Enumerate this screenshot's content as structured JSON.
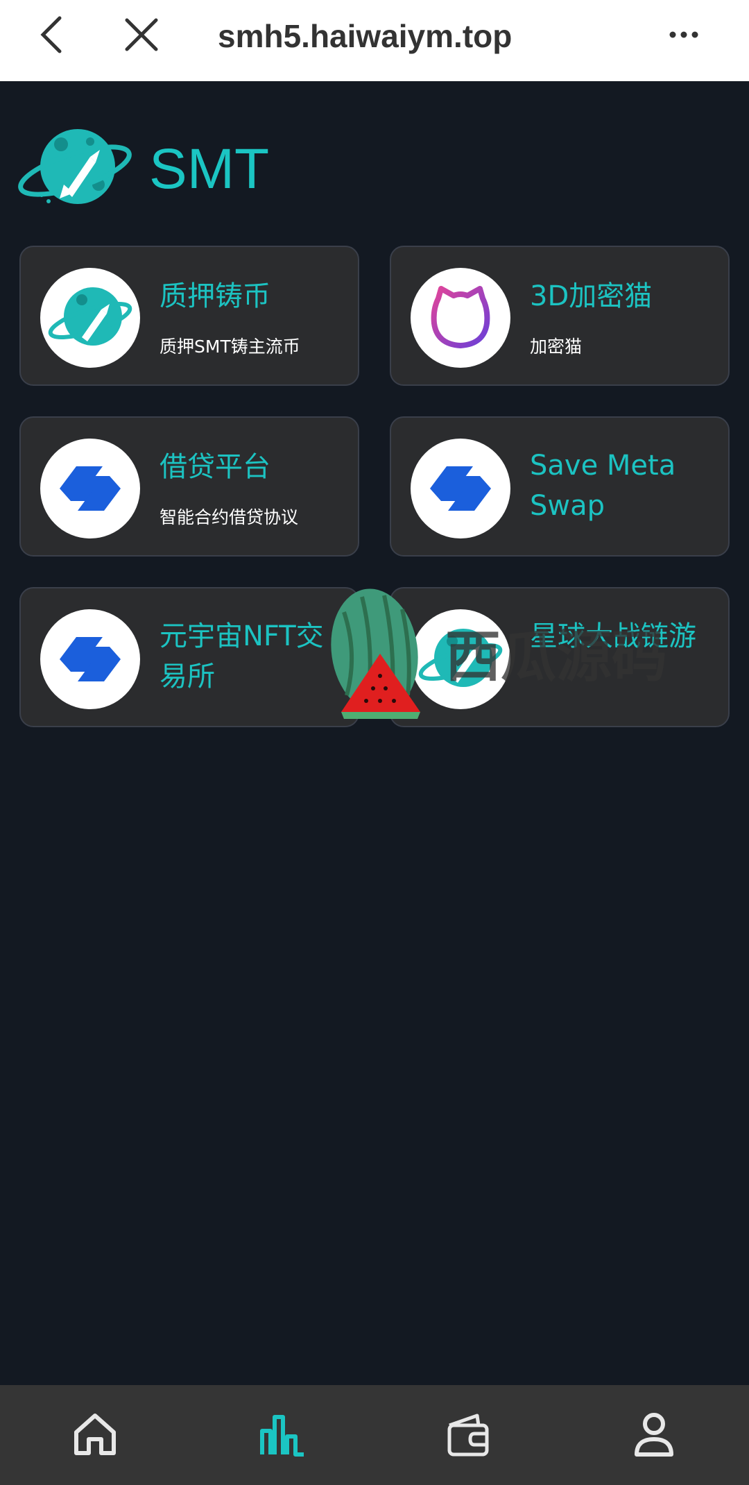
{
  "browser": {
    "url": "smh5.haiwaiym.top",
    "back_icon": "chevron-left-icon",
    "close_icon": "close-icon",
    "more_icon": "more-dots-icon"
  },
  "header": {
    "brand": "SMT",
    "logo_icon": "planet-rocket-logo"
  },
  "cards": [
    {
      "title": "质押铸币",
      "subtitle": "质押SMT铸主流币",
      "icon": "planet-rocket-icon"
    },
    {
      "title": "3D加密猫",
      "subtitle": "加密猫",
      "icon": "cat-icon"
    },
    {
      "title": "借贷平台",
      "subtitle": "智能合约借贷协议",
      "icon": "swap-logo-icon"
    },
    {
      "title": "Save Meta Swap",
      "subtitle": "",
      "icon": "swap-logo-icon"
    },
    {
      "title": "元宇宙NFT交易所",
      "subtitle": "",
      "icon": "swap-logo-icon"
    },
    {
      "title": "星球大战链游",
      "subtitle": "",
      "icon": "planet-rocket-icon"
    }
  ],
  "watermark": {
    "text": "西瓜源码",
    "icon": "watermelon-icon"
  },
  "bottom_nav": [
    {
      "name": "home",
      "icon": "home-icon",
      "active": false
    },
    {
      "name": "market",
      "icon": "chart-bars-icon",
      "active": true
    },
    {
      "name": "wallet",
      "icon": "wallet-icon",
      "active": false
    },
    {
      "name": "profile",
      "icon": "user-icon",
      "active": false
    }
  ],
  "colors": {
    "accent": "#1bc5c3",
    "background": "#131922",
    "card": "#2b2c2e",
    "nav": "#353535",
    "nav_icon": "#e8e8e8"
  }
}
